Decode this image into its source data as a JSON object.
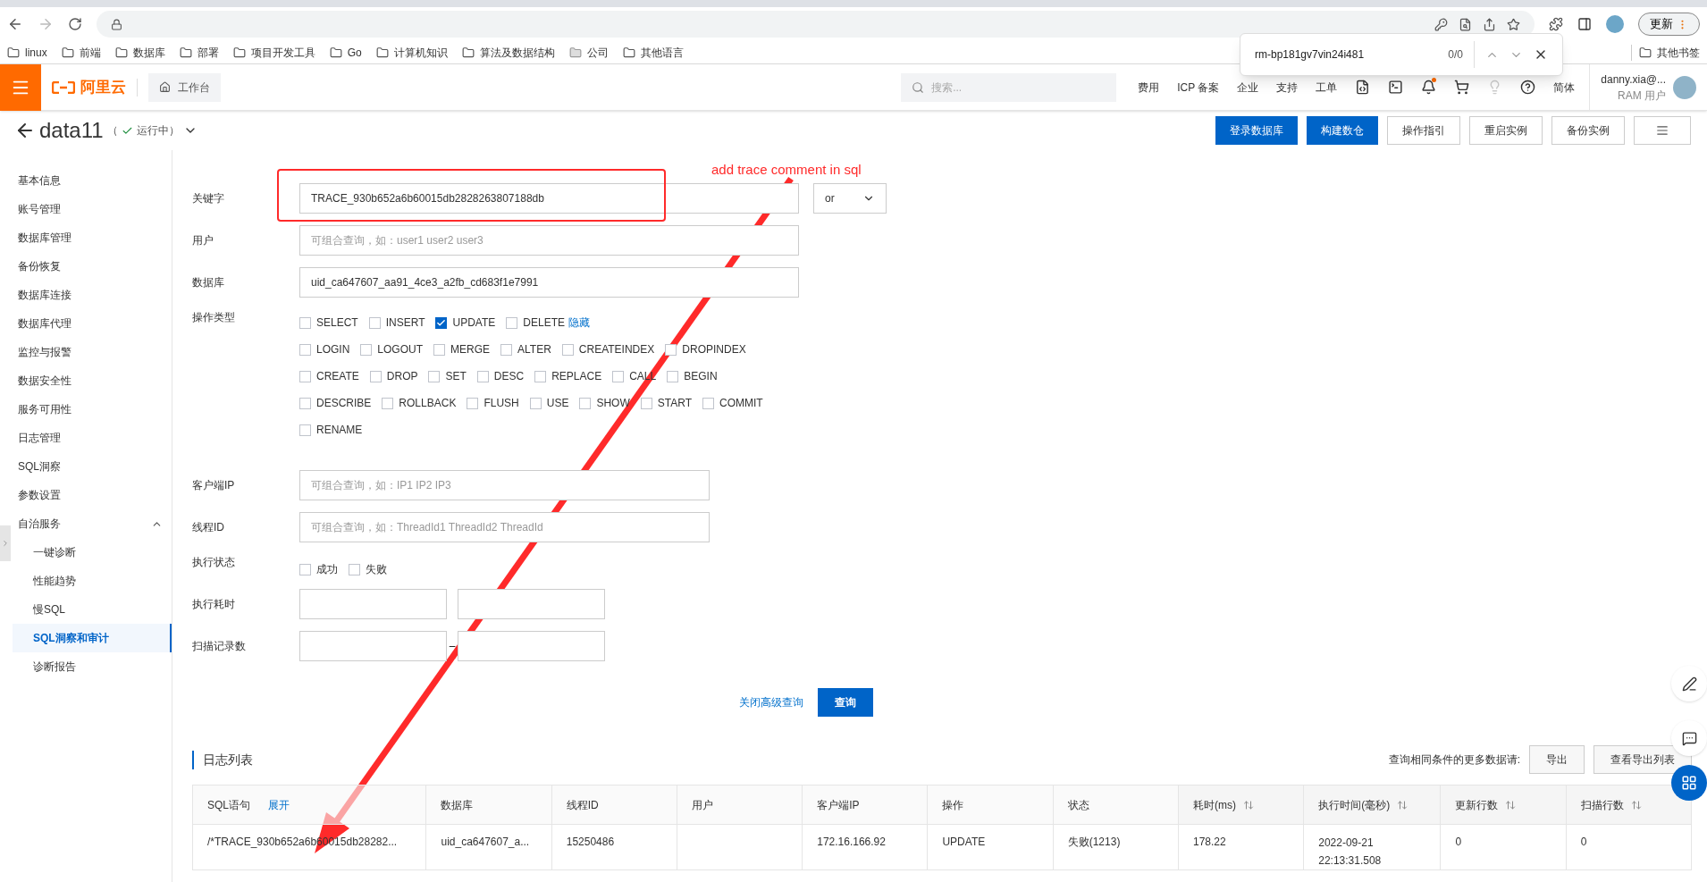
{
  "browser": {
    "bookmarks": [
      {
        "label": "linux",
        "kind": "folder"
      },
      {
        "label": "前端",
        "kind": "folder"
      },
      {
        "label": "数据库",
        "kind": "folder"
      },
      {
        "label": "部署",
        "kind": "folder"
      },
      {
        "label": "项目开发工具",
        "kind": "folder"
      },
      {
        "label": "Go",
        "kind": "folder"
      },
      {
        "label": "计算机知识",
        "kind": "folder"
      },
      {
        "label": "算法及数据结构",
        "kind": "folder"
      },
      {
        "label": "公司",
        "kind": "managed"
      },
      {
        "label": "其他语言",
        "kind": "folder"
      }
    ],
    "other_bookmarks": "其他书签",
    "update_button": "更新",
    "find_bar": {
      "query": "rm-bp181gv7vin24i481",
      "count": "0/0"
    }
  },
  "header": {
    "logo_text": "阿里云",
    "workbench": "工作台",
    "search_placeholder": "搜索...",
    "nav": [
      "费用",
      "ICP 备案",
      "企业",
      "支持",
      "工单"
    ],
    "notification_dot": true,
    "language": "简体",
    "user": {
      "name": "danny.xia@...",
      "role": "RAM 用户"
    }
  },
  "instance": {
    "name": "data11",
    "status_open": "（",
    "status": "运行中",
    "status_close": "）"
  },
  "actions": [
    {
      "label": "登录数据库",
      "kind": "primary"
    },
    {
      "label": "构建数仓",
      "kind": "primary"
    },
    {
      "label": "操作指引",
      "kind": "default"
    },
    {
      "label": "重启实例",
      "kind": "default"
    },
    {
      "label": "备份实例",
      "kind": "default"
    }
  ],
  "sidebar": {
    "items": [
      {
        "label": "基本信息",
        "selected": false
      },
      {
        "label": "账号管理",
        "selected": false
      },
      {
        "label": "数据库管理",
        "selected": false
      },
      {
        "label": "备份恢复",
        "selected": false
      },
      {
        "label": "数据库连接",
        "selected": false
      },
      {
        "label": "数据库代理",
        "selected": false
      },
      {
        "label": "监控与报警",
        "selected": false
      },
      {
        "label": "数据安全性",
        "selected": false
      },
      {
        "label": "服务可用性",
        "selected": false
      },
      {
        "label": "日志管理",
        "selected": false
      },
      {
        "label": "SQL洞察",
        "selected": false
      },
      {
        "label": "参数设置",
        "selected": false
      },
      {
        "label": "自治服务",
        "selected": false,
        "expanded": true,
        "children": [
          {
            "label": "一键诊断",
            "selected": false
          },
          {
            "label": "性能趋势",
            "selected": false
          },
          {
            "label": "慢SQL",
            "selected": false
          },
          {
            "label": "SQL洞察和审计",
            "selected": true
          },
          {
            "label": "诊断报告",
            "selected": false
          }
        ]
      }
    ]
  },
  "form": {
    "keyword": {
      "label": "关键字",
      "value": "TRACE_930b652a6b60015db2828263807188db",
      "logic": "or"
    },
    "user": {
      "label": "用户",
      "placeholder": "可组合查询，如：user1 user2 user3"
    },
    "database": {
      "label": "数据库",
      "value": "uid_ca647607_aa91_4ce3_a2fb_cd683f1e7991"
    },
    "op_types": {
      "label": "操作类型",
      "toggle_link": "隐藏",
      "rows": [
        [
          {
            "label": "SELECT",
            "checked": false
          },
          {
            "label": "INSERT",
            "checked": false
          },
          {
            "label": "UPDATE",
            "checked": true
          },
          {
            "label": "DELETE",
            "checked": false
          }
        ],
        [
          {
            "label": "LOGIN",
            "checked": false
          },
          {
            "label": "LOGOUT",
            "checked": false
          },
          {
            "label": "MERGE",
            "checked": false
          },
          {
            "label": "ALTER",
            "checked": false
          },
          {
            "label": "CREATEINDEX",
            "checked": false
          },
          {
            "label": "DROPINDEX",
            "checked": false
          }
        ],
        [
          {
            "label": "CREATE",
            "checked": false
          },
          {
            "label": "DROP",
            "checked": false
          },
          {
            "label": "SET",
            "checked": false
          },
          {
            "label": "DESC",
            "checked": false
          },
          {
            "label": "REPLACE",
            "checked": false
          },
          {
            "label": "CALL",
            "checked": false
          },
          {
            "label": "BEGIN",
            "checked": false
          }
        ],
        [
          {
            "label": "DESCRIBE",
            "checked": false
          },
          {
            "label": "ROLLBACK",
            "checked": false
          },
          {
            "label": "FLUSH",
            "checked": false
          },
          {
            "label": "USE",
            "checked": false
          },
          {
            "label": "SHOW",
            "checked": false
          },
          {
            "label": "START",
            "checked": false
          },
          {
            "label": "COMMIT",
            "checked": false
          }
        ],
        [
          {
            "label": "RENAME",
            "checked": false
          }
        ]
      ]
    },
    "client_ip": {
      "label": "客户端IP",
      "placeholder": "可组合查询，如：IP1 IP2 IP3"
    },
    "thread_id": {
      "label": "线程ID",
      "placeholder": "可组合查询，如：ThreadId1 ThreadId2 ThreadId"
    },
    "exec_status": {
      "label": "执行状态",
      "options": [
        {
          "label": "成功",
          "checked": false
        },
        {
          "label": "失败",
          "checked": false
        }
      ]
    },
    "exec_time": {
      "label": "执行耗时"
    },
    "scan_rows": {
      "label": "扫描记录数",
      "separator": "–"
    },
    "close_advanced": "关闭高级查询",
    "submit": "查询"
  },
  "log_list": {
    "title": "日志列表",
    "more_label": "查询相同条件的更多数据请:",
    "buttons": [
      "导出",
      "查看导出列表"
    ],
    "expand_link": "展开",
    "columns": [
      {
        "label": "SQL语句",
        "sortable": false
      },
      {
        "label": "数据库",
        "sortable": false
      },
      {
        "label": "线程ID",
        "sortable": false
      },
      {
        "label": "用户",
        "sortable": false
      },
      {
        "label": "客户端IP",
        "sortable": false
      },
      {
        "label": "操作",
        "sortable": false
      },
      {
        "label": "状态",
        "sortable": false
      },
      {
        "label": "耗时(ms)",
        "sortable": true
      },
      {
        "label": "执行时间(毫秒)",
        "sortable": true
      },
      {
        "label": "更新行数",
        "sortable": true
      },
      {
        "label": "扫描行数",
        "sortable": true
      }
    ],
    "rows": [
      {
        "cells": [
          "/*TRACE_930b652a6b60015db28282...",
          "uid_ca647607_a...",
          "15250486",
          null,
          "172.16.166.92",
          "UPDATE",
          "失败(1213)",
          "178.22",
          "2022-09-21 22:13:31.508",
          "0",
          "0"
        ]
      }
    ]
  },
  "annotation": {
    "text": "add trace comment in sql"
  }
}
